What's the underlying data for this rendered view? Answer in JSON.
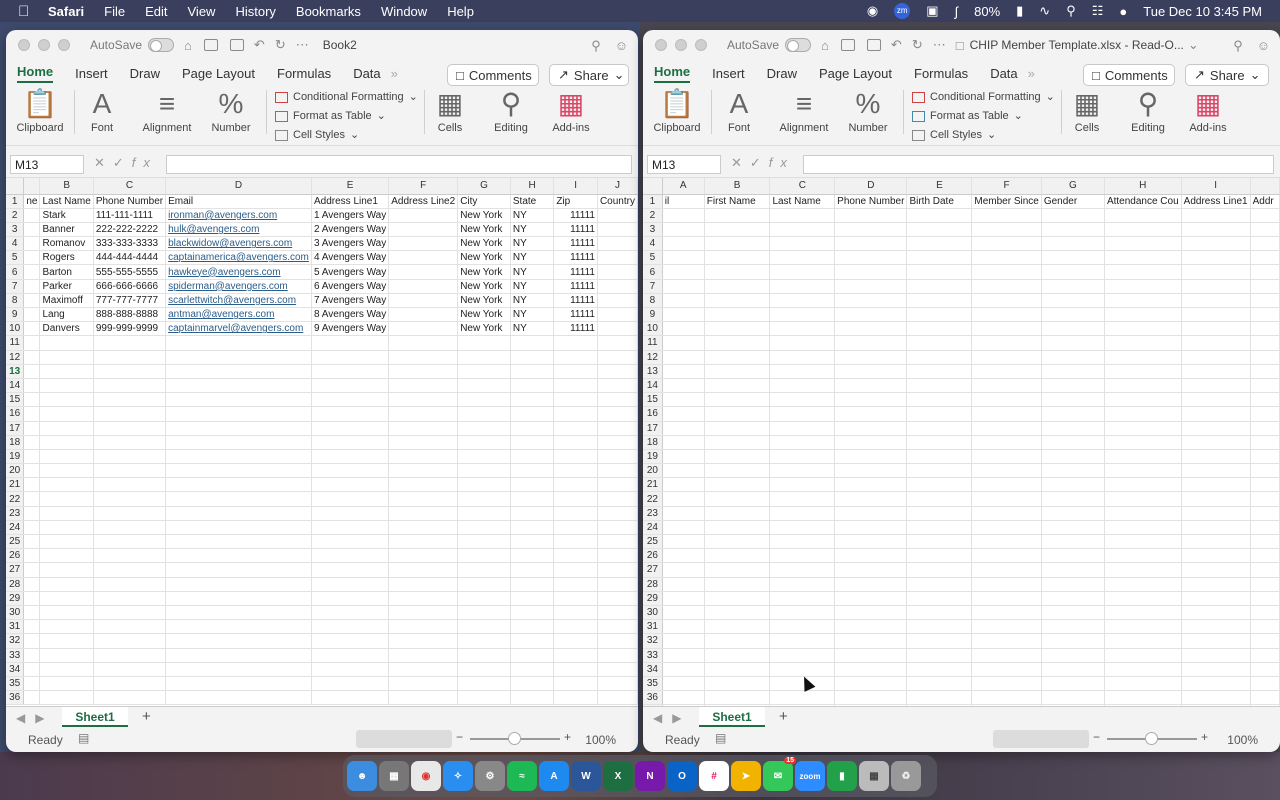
{
  "menubar": {
    "app": "Safari",
    "items": [
      "File",
      "Edit",
      "View",
      "History",
      "Bookmarks",
      "Window",
      "Help"
    ],
    "zoom_label": "zm",
    "battery": "80%",
    "datetime": "Tue Dec 10  3:45 PM"
  },
  "left_window": {
    "autosave": "AutoSave",
    "title": "Book2",
    "tabs": [
      "Home",
      "Insert",
      "Draw",
      "Page Layout",
      "Formulas",
      "Data"
    ],
    "comments": "Comments",
    "share": "Share",
    "ribbon": {
      "clipboard": "Clipboard",
      "font": "Font",
      "alignment": "Alignment",
      "number": "Number",
      "conditional": "Conditional Formatting",
      "format_table": "Format as Table",
      "cell_styles": "Cell Styles",
      "cells": "Cells",
      "editing": "Editing",
      "addins": "Add-ins"
    },
    "namebox": "M13",
    "columns": [
      "B",
      "C",
      "D",
      "E",
      "F",
      "G",
      "H",
      "I",
      "J"
    ],
    "first_col_header_fragment": "ne",
    "header_row": [
      "Last Name",
      "Phone Number",
      "Email",
      "Address Line1",
      "Address Line2",
      "City",
      "State",
      "Zip",
      "Country"
    ],
    "rows": [
      [
        "Stark",
        "111-111-1111",
        "ironman@avengers.com",
        "1 Avengers Way",
        "",
        "New York",
        "NY",
        "11111",
        ""
      ],
      [
        "Banner",
        "222-222-2222",
        "hulk@avengers.com",
        "2 Avengers Way",
        "",
        "New York",
        "NY",
        "11111",
        ""
      ],
      [
        "Romanov",
        "333-333-3333",
        "blackwidow@avengers.com",
        "3 Avengers Way",
        "",
        "New York",
        "NY",
        "11111",
        ""
      ],
      [
        "Rogers",
        "444-444-4444",
        "captainamerica@avengers.com",
        "4 Avengers Way",
        "",
        "New York",
        "NY",
        "11111",
        ""
      ],
      [
        "Barton",
        "555-555-5555",
        "hawkeye@avengers.com",
        "5 Avengers Way",
        "",
        "New York",
        "NY",
        "11111",
        ""
      ],
      [
        "Parker",
        "666-666-6666",
        "spiderman@avengers.com",
        "6 Avengers Way",
        "",
        "New York",
        "NY",
        "11111",
        ""
      ],
      [
        "Maximoff",
        "777-777-7777",
        "scarlettwitch@avengers.com",
        "7 Avengers Way",
        "",
        "New York",
        "NY",
        "11111",
        ""
      ],
      [
        "Lang",
        "888-888-8888",
        "antman@avengers.com",
        "8 Avengers Way",
        "",
        "New York",
        "NY",
        "11111",
        ""
      ],
      [
        "Danvers",
        "999-999-9999",
        "captainmarvel@avengers.com",
        "9 Avengers Way",
        "",
        "New York",
        "NY",
        "11111",
        ""
      ]
    ],
    "row_count": 36,
    "selected_row": 13,
    "sheet": "Sheet1",
    "status": "Ready",
    "zoom": "100%"
  },
  "right_window": {
    "autosave": "AutoSave",
    "title": "CHIP Member Template.xlsx  -  Read-O...",
    "tabs": [
      "Home",
      "Insert",
      "Draw",
      "Page Layout",
      "Formulas",
      "Data"
    ],
    "comments": "Comments",
    "share": "Share",
    "ribbon": {
      "clipboard": "Clipboard",
      "font": "Font",
      "alignment": "Alignment",
      "number": "Number",
      "conditional": "Conditional Formatting",
      "format_table": "Format as Table",
      "cell_styles": "Cell Styles",
      "cells": "Cells",
      "editing": "Editing",
      "addins": "Add-ins"
    },
    "namebox": "M13",
    "columns": [
      "A",
      "B",
      "C",
      "D",
      "E",
      "F",
      "G",
      "H",
      "I"
    ],
    "header_row": [
      "il",
      "First Name",
      "Last Name",
      "Phone Number",
      "Birth Date",
      "Member Since",
      "Gender",
      "Attendance Cou",
      "Address Line1",
      "Addr"
    ],
    "row_count": 38,
    "sheet": "Sheet1",
    "status": "Ready",
    "zoom": "100%"
  },
  "dock": {
    "badge": "15",
    "zoom_label": "zoom"
  }
}
